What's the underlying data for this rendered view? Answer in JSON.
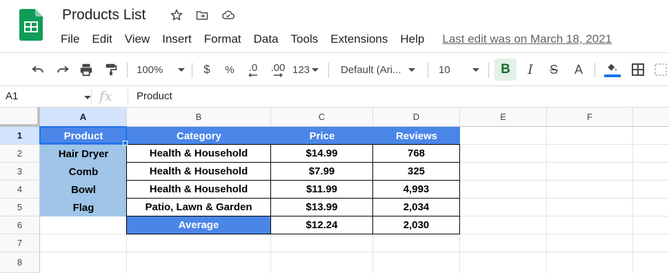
{
  "doc": {
    "title": "Products List",
    "last_edit": "Last edit was on March 18, 2021"
  },
  "menu": [
    "File",
    "Edit",
    "View",
    "Insert",
    "Format",
    "Data",
    "Tools",
    "Extensions",
    "Help"
  ],
  "toolbar": {
    "zoom": "100%",
    "currency": "$",
    "percent": "%",
    "decrease_decimal": ".0",
    "increase_decimal": ".00",
    "more_formats": "123",
    "font": "Default (Ari...",
    "font_size": "10",
    "bold": "B",
    "italic": "I",
    "strikethrough": "S",
    "text_color": "A"
  },
  "formula_bar": {
    "cell_ref": "A1",
    "fx": "fx",
    "value": "Product"
  },
  "columns": [
    "A",
    "B",
    "C",
    "D",
    "E",
    "F"
  ],
  "rows": [
    "1",
    "2",
    "3",
    "4",
    "5",
    "6",
    "7",
    "8"
  ],
  "table": {
    "header": [
      "Product",
      "Category",
      "Price",
      "Reviews"
    ],
    "rows": [
      [
        "Hair Dryer",
        "Health & Household",
        "$14.99",
        "768"
      ],
      [
        "Comb",
        "Health & Household",
        "$7.99",
        "325"
      ],
      [
        "Bowl",
        "Health & Household",
        "$11.99",
        "4,993"
      ],
      [
        "Flag",
        "Patio, Lawn & Garden",
        "$13.99",
        "2,034"
      ]
    ],
    "average": [
      "Average",
      "$12.24",
      "2,030"
    ]
  },
  "colors": {
    "header_fill": "#4a86e8",
    "product_fill": "#9fc5e8",
    "selection": "#1a73e8",
    "sheets_green": "#0f9d58",
    "fill_color_bar": "#1a73e8"
  },
  "icons": [
    "sheets-logo-icon",
    "star-icon",
    "move-folder-icon",
    "cloud-saved-icon",
    "undo-icon",
    "redo-icon",
    "print-icon",
    "paint-format-icon",
    "fill-color-icon",
    "borders-icon",
    "merge-cells-icon"
  ]
}
